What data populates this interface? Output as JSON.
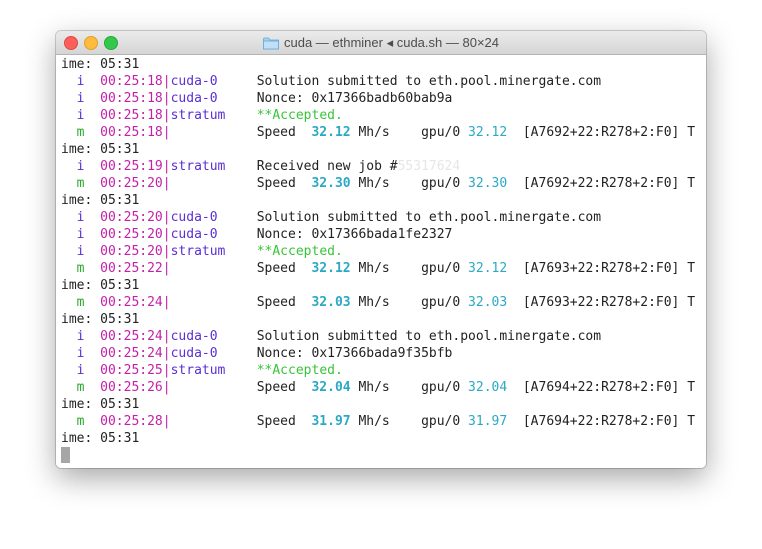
{
  "window": {
    "title": "cuda — ethminer ◂ cuda.sh — 80×24"
  },
  "lines": [
    {
      "kind": "plain",
      "text": "ime: 05:31"
    },
    {
      "kind": "log",
      "lvl": "i",
      "time": "00:25:18",
      "src": "cuda-0",
      "msg": "Solution submitted to eth.pool.minergate.com"
    },
    {
      "kind": "log",
      "lvl": "i",
      "time": "00:25:18",
      "src": "cuda-0",
      "msg": "Nonce: 0x17366badb60bab9a"
    },
    {
      "kind": "accepted",
      "lvl": "i",
      "time": "00:25:18",
      "src": "stratum",
      "msg": "**Accepted."
    },
    {
      "kind": "speed",
      "lvl": "m",
      "time": "00:25:18",
      "speed": "32.12",
      "unit": "Mh/s",
      "gpu": "gpu/0",
      "gpuval": "32.12",
      "stats": "[A7692+22:R278+2:F0] T"
    },
    {
      "kind": "plain",
      "text": "ime: 05:31"
    },
    {
      "kind": "job",
      "lvl": "i",
      "time": "00:25:19",
      "src": "stratum",
      "msg": "Received new job #",
      "job": "55317624"
    },
    {
      "kind": "speed",
      "lvl": "m",
      "time": "00:25:20",
      "speed": "32.30",
      "unit": "Mh/s",
      "gpu": "gpu/0",
      "gpuval": "32.30",
      "stats": "[A7692+22:R278+2:F0] T"
    },
    {
      "kind": "plain",
      "text": "ime: 05:31"
    },
    {
      "kind": "log",
      "lvl": "i",
      "time": "00:25:20",
      "src": "cuda-0",
      "msg": "Solution submitted to eth.pool.minergate.com"
    },
    {
      "kind": "log",
      "lvl": "i",
      "time": "00:25:20",
      "src": "cuda-0",
      "msg": "Nonce: 0x17366bada1fe2327"
    },
    {
      "kind": "accepted",
      "lvl": "i",
      "time": "00:25:20",
      "src": "stratum",
      "msg": "**Accepted."
    },
    {
      "kind": "speed",
      "lvl": "m",
      "time": "00:25:22",
      "speed": "32.12",
      "unit": "Mh/s",
      "gpu": "gpu/0",
      "gpuval": "32.12",
      "stats": "[A7693+22:R278+2:F0] T"
    },
    {
      "kind": "plain",
      "text": "ime: 05:31"
    },
    {
      "kind": "speed",
      "lvl": "m",
      "time": "00:25:24",
      "speed": "32.03",
      "unit": "Mh/s",
      "gpu": "gpu/0",
      "gpuval": "32.03",
      "stats": "[A7693+22:R278+2:F0] T"
    },
    {
      "kind": "plain",
      "text": "ime: 05:31"
    },
    {
      "kind": "log",
      "lvl": "i",
      "time": "00:25:24",
      "src": "cuda-0",
      "msg": "Solution submitted to eth.pool.minergate.com"
    },
    {
      "kind": "log",
      "lvl": "i",
      "time": "00:25:24",
      "src": "cuda-0",
      "msg": "Nonce: 0x17366bada9f35bfb"
    },
    {
      "kind": "accepted",
      "lvl": "i",
      "time": "00:25:25",
      "src": "stratum",
      "msg": "**Accepted."
    },
    {
      "kind": "speed",
      "lvl": "m",
      "time": "00:25:26",
      "speed": "32.04",
      "unit": "Mh/s",
      "gpu": "gpu/0",
      "gpuval": "32.04",
      "stats": "[A7694+22:R278+2:F0] T"
    },
    {
      "kind": "plain",
      "text": "ime: 05:31"
    },
    {
      "kind": "speed",
      "lvl": "m",
      "time": "00:25:28",
      "speed": "31.97",
      "unit": "Mh/s",
      "gpu": "gpu/0",
      "gpuval": "31.97",
      "stats": "[A7694+22:R278+2:F0] T"
    },
    {
      "kind": "plain",
      "text": "ime: 05:31"
    }
  ]
}
